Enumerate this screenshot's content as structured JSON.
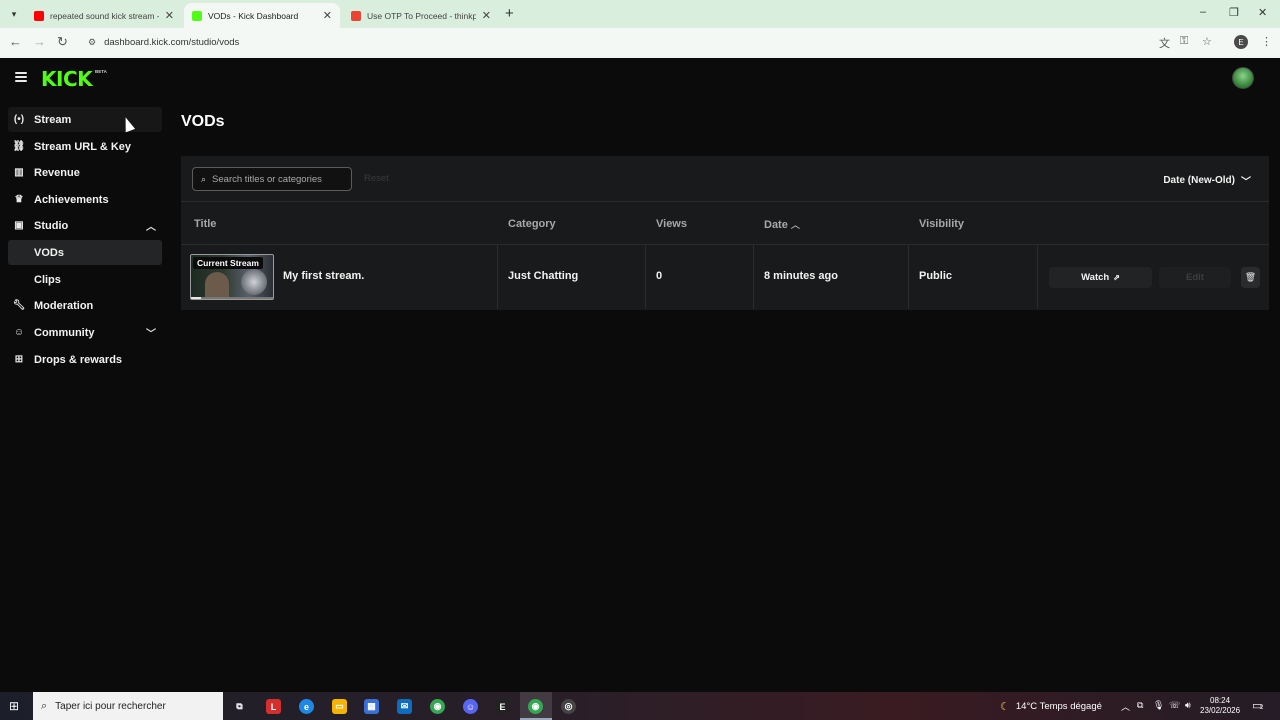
{
  "browser": {
    "tabs": [
      {
        "title": "repeated sound kick stream - Y",
        "active": false,
        "favicon_color": "#ff0000",
        "favicon": "youtube-icon"
      },
      {
        "title": "VODs - Kick Dashboard",
        "active": true,
        "favicon_color": "#53fc18",
        "favicon": "kick-icon"
      },
      {
        "title": "Use OTP To Proceed - thinkpad",
        "active": false,
        "favicon_color": "#ea4335",
        "favicon": "gmail-icon"
      }
    ],
    "url": "dashboard.kick.com/studio/vods",
    "profile_initial": "E"
  },
  "app": {
    "logo": "KICK",
    "beta": "BETA",
    "brand_color": "#53fc18"
  },
  "sidebar": {
    "items": [
      {
        "label": "Stream",
        "icon": "broadcast-icon"
      },
      {
        "label": "Stream URL & Key",
        "icon": "link-icon"
      },
      {
        "label": "Revenue",
        "icon": "chart-icon"
      },
      {
        "label": "Achievements",
        "icon": "trophy-icon"
      },
      {
        "label": "Studio",
        "icon": "studio-icon",
        "expanded": true
      },
      {
        "label": "VODs",
        "sub": true,
        "selected": true
      },
      {
        "label": "Clips",
        "sub": true
      },
      {
        "label": "Moderation",
        "icon": "wrench-icon"
      },
      {
        "label": "Community",
        "icon": "users-icon",
        "expanded": false
      },
      {
        "label": "Drops & rewards",
        "icon": "gift-icon"
      }
    ]
  },
  "main": {
    "title": "VODs",
    "search_placeholder": "Search titles or categories",
    "reset_label": "Reset",
    "sort_label": "Date (New-Old)",
    "columns": [
      "Title",
      "Category",
      "Views",
      "Date",
      "Visibility"
    ],
    "rows": [
      {
        "badge": "Current Stream",
        "title": "My first stream.",
        "category": "Just Chatting",
        "views": "0",
        "date": "8 minutes ago",
        "visibility": "Public",
        "progress": 0.12,
        "watch_label": "Watch",
        "edit_label": "Edit"
      }
    ]
  },
  "taskbar": {
    "search_placeholder": "Taper ici pour rechercher",
    "weather": "14°C  Temps dégagé",
    "time": "08:24",
    "date": "23/02/2026",
    "notifications": "2"
  }
}
